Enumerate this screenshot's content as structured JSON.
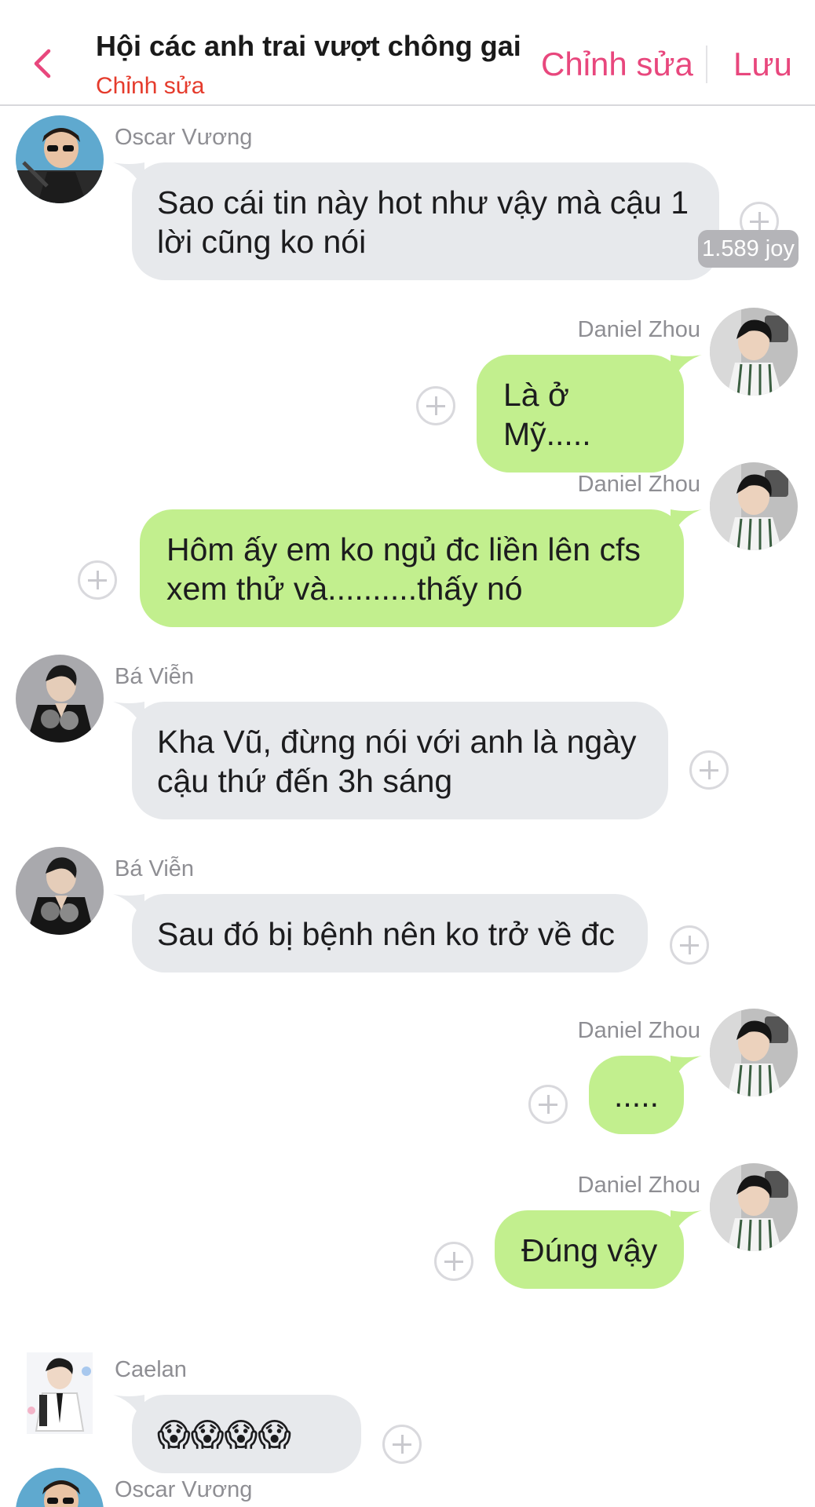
{
  "header": {
    "back_icon": "chevron-left-icon",
    "title": "Hội các anh trai vượt chông gai",
    "subtitle": "Chỉnh sửa",
    "edit_label": "Chỉnh sửa",
    "save_label": "Lưu"
  },
  "colors": {
    "accent": "#e8477d",
    "subtitle": "#e53b2c",
    "incoming_bubble": "#e7e9ec",
    "outgoing_bubble": "#c2ef8e",
    "badge": "#b4b4b8"
  },
  "badge": {
    "joy": "1.589 joy"
  },
  "messages": [
    {
      "sender": "Oscar Vương",
      "side": "left",
      "text": "Sao cái tin này hot như vậy mà cậu 1 lời cũng ko nói"
    },
    {
      "sender": "Daniel Zhou",
      "side": "right",
      "text": "Là ở Mỹ....."
    },
    {
      "sender": "Daniel Zhou",
      "side": "right",
      "text": "Hôm ấy em ko ngủ đc liền lên cfs xem thử và..........thấy nó"
    },
    {
      "sender": "Bá Viễn",
      "side": "left",
      "text": "Kha Vũ, đừng nói với anh là ngày cậu thứ đến 3h sáng"
    },
    {
      "sender": "Bá Viễn",
      "side": "left",
      "text": "Sau đó bị bệnh nên ko trở về đc"
    },
    {
      "sender": "Daniel Zhou",
      "side": "right",
      "text": "....."
    },
    {
      "sender": "Daniel Zhou",
      "side": "right",
      "text": "Đúng vậy"
    },
    {
      "sender": "Caelan",
      "side": "left",
      "text": "😱😱😱😱",
      "emoji_icon": "face-screaming-in-fear-icon"
    },
    {
      "sender": "Oscar Vương",
      "side": "left",
      "text": ""
    }
  ],
  "icons": {
    "add_reaction": "plus-circle-icon"
  }
}
